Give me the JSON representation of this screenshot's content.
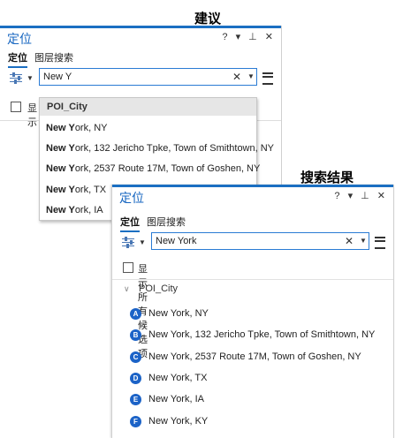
{
  "captions": {
    "suggest": "建议",
    "results": "搜索结果"
  },
  "pane": {
    "title": "定位",
    "controls": "? ▾ ⊥ ✕",
    "tabs": [
      "定位",
      "图层搜索"
    ],
    "show_all_label": "显示所有候选项",
    "show_all_partial": "显示"
  },
  "suggest_view": {
    "query": "New Y",
    "dropdown_header": "POI_City",
    "items": [
      {
        "bold": "New Y",
        "rest": "ork, NY"
      },
      {
        "bold": "New Y",
        "rest": "ork, 132 Jericho Tpke, Town of Smithtown, NY"
      },
      {
        "bold": "New Y",
        "rest": "ork, 2537 Route 17M, Town of Goshen, NY"
      },
      {
        "bold": "New Y",
        "rest": "ork, TX"
      },
      {
        "bold": "New Y",
        "rest": "ork, IA"
      }
    ]
  },
  "results_view": {
    "query": "New York",
    "group": "POI_City",
    "results": [
      {
        "badge": "A",
        "text": "New York, NY"
      },
      {
        "badge": "B",
        "text": "New York, 132 Jericho Tpke, Town of Smithtown, NY"
      },
      {
        "badge": "C",
        "text": "New York, 2537 Route 17M, Town of Goshen, NY"
      },
      {
        "badge": "D",
        "text": "New York, TX"
      },
      {
        "badge": "E",
        "text": "New York, IA"
      },
      {
        "badge": "F",
        "text": "New York, KY"
      }
    ]
  },
  "colors": {
    "accent": "#1b6fc2",
    "badge": "#1c63c7"
  },
  "icons": {
    "filter": "filter-sliders-icon",
    "menu": "hamburger-menu-icon",
    "clear": "clear-x-icon"
  }
}
